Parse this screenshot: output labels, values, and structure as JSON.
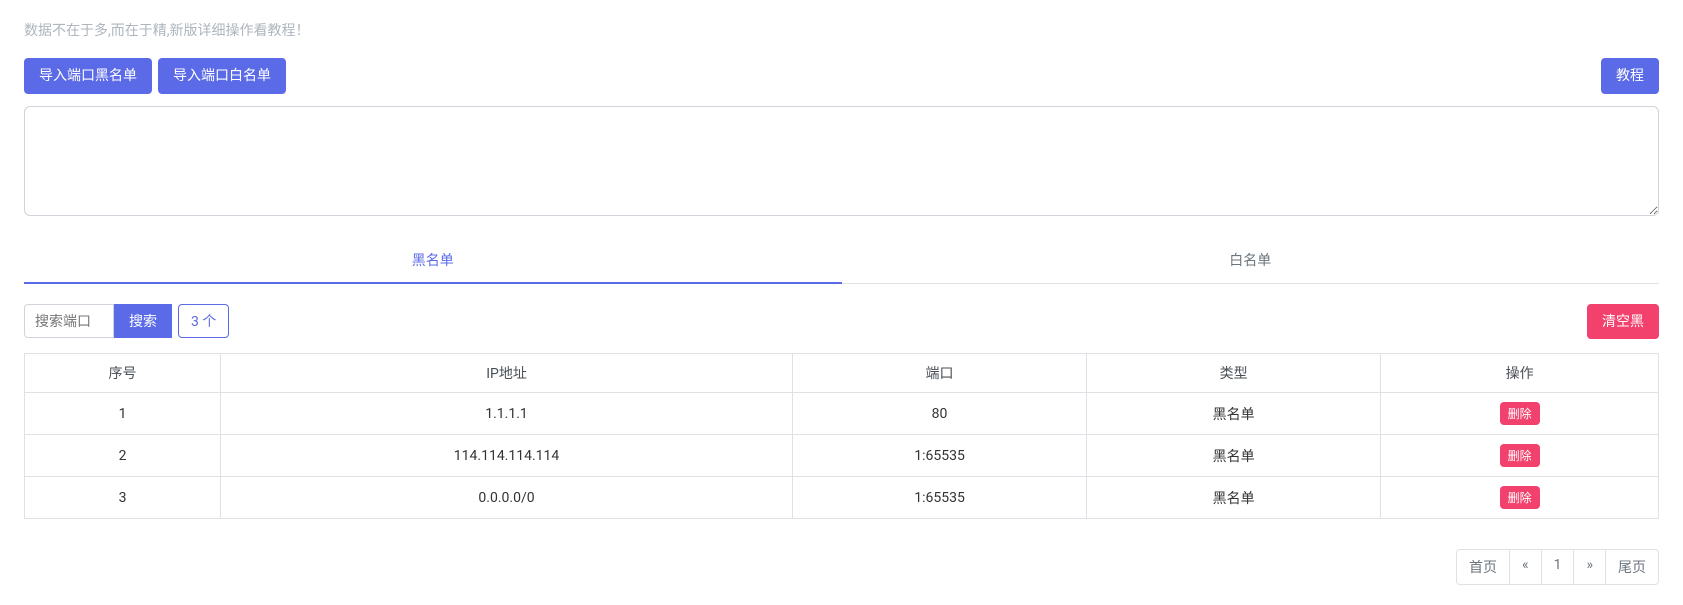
{
  "hint": "数据不在于多,而在于精,新版详细操作看教程！",
  "buttons": {
    "import_black": "导入端口黑名单",
    "import_white": "导入端口白名单",
    "tutorial": "教程",
    "search": "搜索",
    "clear_black": "清空黑",
    "delete": "删除"
  },
  "textarea_value": "",
  "tabs": {
    "black": "黑名单",
    "white": "白名单"
  },
  "search": {
    "placeholder": "搜索端口",
    "value": "",
    "count_label": "3 个"
  },
  "table": {
    "headers": {
      "seq": "序号",
      "ip": "IP地址",
      "port": "端口",
      "type": "类型",
      "op": "操作"
    },
    "rows": [
      {
        "seq": "1",
        "ip": "1.1.1.1",
        "port": "80",
        "type": "黑名单"
      },
      {
        "seq": "2",
        "ip": "114.114.114.114",
        "port": "1:65535",
        "type": "黑名单"
      },
      {
        "seq": "3",
        "ip": "0.0.0.0/0",
        "port": "1:65535",
        "type": "黑名单"
      }
    ]
  },
  "pagination": {
    "first": "首页",
    "prev": "«",
    "current": "1",
    "next": "»",
    "last": "尾页"
  }
}
